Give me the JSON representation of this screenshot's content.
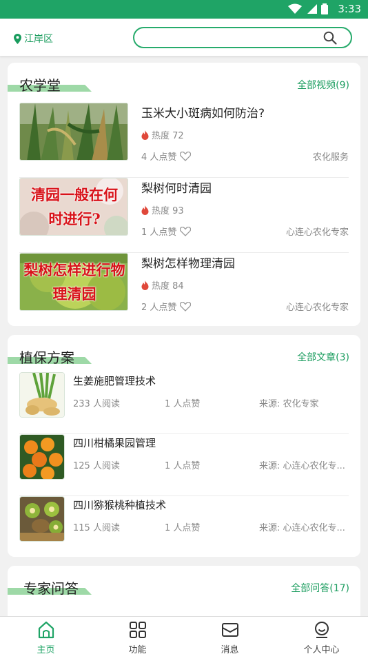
{
  "status_bar": {
    "time": "3:33"
  },
  "header": {
    "location": "江岸区",
    "search_placeholder": ""
  },
  "sections": {
    "agri_school": {
      "title": "农学堂",
      "more": "全部视频(9)",
      "items": [
        {
          "title": "玉米大小斑病如何防治?",
          "heat": "热度 72",
          "likes": "4 人点赞",
          "source": "农化服务",
          "thumb_text": ""
        },
        {
          "title": "梨树何时清园",
          "heat": "热度 93",
          "likes": "1 人点赞",
          "source": "心连心农化专家",
          "thumb_text": "清园一般在何时进行?"
        },
        {
          "title": "梨树怎样物理清园",
          "heat": "热度 84",
          "likes": "2 人点赞",
          "source": "心连心农化专家",
          "thumb_text": "梨树怎样进行物理清园"
        }
      ]
    },
    "plant_protection": {
      "title": "植保方案",
      "more": "全部文章(3)",
      "items": [
        {
          "title": "生姜施肥管理技术",
          "reads": "233 人阅读",
          "likes": "1 人点赞",
          "source": "来源: 农化专家"
        },
        {
          "title": "四川柑橘果园管理",
          "reads": "125 人阅读",
          "likes": "1 人点赞",
          "source": "来源: 心连心农化专..."
        },
        {
          "title": "四川猕猴桃种植技术",
          "reads": "115 人阅读",
          "likes": "1 人点赞",
          "source": "来源: 心连心农化专..."
        }
      ]
    },
    "expert_qa": {
      "title": "专家问答",
      "more": "全部问答(17)"
    }
  },
  "tabbar": {
    "tabs": [
      {
        "label": "主页",
        "icon": "home-icon",
        "active": true
      },
      {
        "label": "功能",
        "icon": "grid-icon",
        "active": false
      },
      {
        "label": "消息",
        "icon": "message-icon",
        "active": false
      },
      {
        "label": "个人中心",
        "icon": "profile-icon",
        "active": false
      }
    ]
  },
  "colors": {
    "brand": "#1fa466",
    "accent_band": "#9ed9a7",
    "muted": "#888888"
  }
}
